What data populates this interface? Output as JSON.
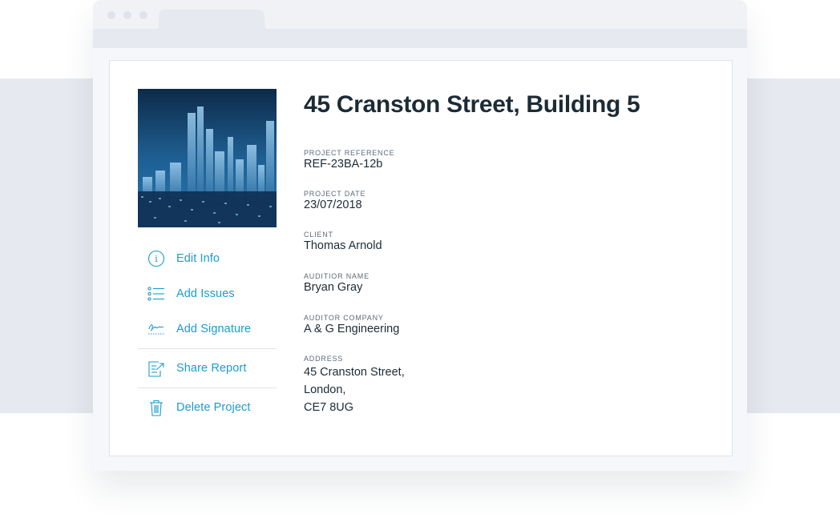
{
  "project": {
    "title": "45 Cranston Street, Building 5",
    "fields": [
      {
        "label": "PROJECT REFERENCE",
        "value": "REF-23BA-12b"
      },
      {
        "label": "PROJECT DATE",
        "value": "23/07/2018"
      },
      {
        "label": "CLIENT",
        "value": "Thomas Arnold"
      },
      {
        "label": "AUDITIOR NAME",
        "value": "Bryan Gray"
      },
      {
        "label": "AUDITOR COMPANY",
        "value": "A & G Engineering"
      }
    ],
    "address": {
      "label": "ADDRESS",
      "lines": [
        "45 Cranston Street,",
        "London,",
        "CE7 8UG"
      ]
    }
  },
  "actions": [
    {
      "label": "Edit Info",
      "icon": "info-icon"
    },
    {
      "label": "Add Issues",
      "icon": "list-icon"
    },
    {
      "label": "Add Signature",
      "icon": "signature-icon"
    },
    {
      "label": "Share Report",
      "icon": "share-report-icon"
    },
    {
      "label": "Delete Project",
      "icon": "trash-icon"
    }
  ],
  "colors": {
    "accent": "#1b9bd1",
    "text": "#1c2b36",
    "background_band": "#e6e9ef"
  }
}
